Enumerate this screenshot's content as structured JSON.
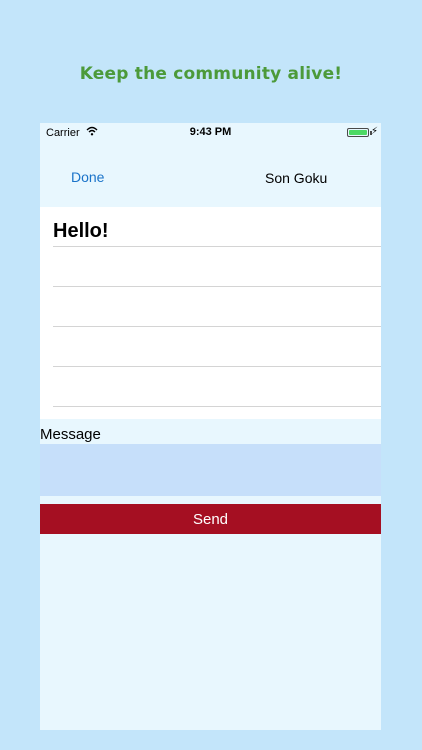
{
  "promo": {
    "headline": "Keep the community alive!"
  },
  "status_bar": {
    "carrier": "Carrier",
    "time": "9:43 PM",
    "wifi_icon": "wifi-icon",
    "battery_icon": "battery-icon",
    "charging_icon": "bolt-icon",
    "battery_level": 1.0
  },
  "navbar": {
    "done_label": "Done",
    "title": "Son Goku"
  },
  "conversation": {
    "greeting": "Hello!"
  },
  "composer": {
    "label": "Message",
    "value": "",
    "send_label": "Send"
  },
  "colors": {
    "background": "#c3e5fa",
    "headline": "#4c9a3a",
    "link": "#1a73c9",
    "input": "#c6dffa",
    "send": "#a50f22",
    "battery": "#4cd964"
  }
}
